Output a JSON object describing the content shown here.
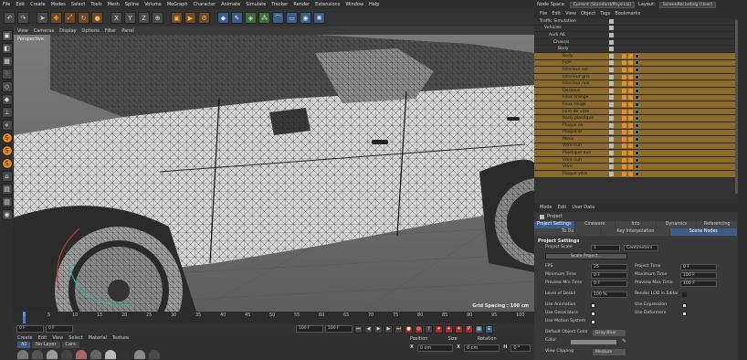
{
  "menubar": [
    "File",
    "Edit",
    "Create",
    "Modes",
    "Select",
    "Tools",
    "Mesh",
    "Spline",
    "Volume",
    "MoGraph",
    "Character",
    "Animate",
    "Simulate",
    "Tracker",
    "Render",
    "Extensions",
    "Window",
    "Help"
  ],
  "topright": {
    "node_space_label": "Node Space:",
    "node_space_value": "Current (Standard/Physical)",
    "layout_label": "Layout:",
    "layout_value": "ScreenRecording (User)"
  },
  "toolbar_icons": [
    "undo-icon",
    "redo-icon",
    "select-icon",
    "move-icon",
    "scale-icon",
    "rotate-icon",
    "recent-icon",
    "x-axis-icon",
    "y-axis-icon",
    "z-axis-icon",
    "coord-icon",
    "render-view-icon",
    "render-icon",
    "render-settings-icon",
    "cube-icon",
    "pen-icon",
    "subdivision-icon",
    "cloner-icon",
    "deformer-icon",
    "floor-icon",
    "camera-icon",
    "light-icon"
  ],
  "viewport": {
    "menu": [
      "View",
      "Cameras",
      "Display",
      "Options",
      "Filter",
      "Panel"
    ],
    "label": "Perspective",
    "grid_spacing": "Grid Spacing : 100 cm"
  },
  "timeline": {
    "ticks": [
      "0",
      "5",
      "10",
      "15",
      "20",
      "25",
      "30",
      "35",
      "40",
      "45",
      "50",
      "55",
      "60",
      "65",
      "70",
      "75",
      "80",
      "85",
      "90",
      "95",
      "100"
    ],
    "start_field": "0 F",
    "current_field": "0 F",
    "end_field": "100 F",
    "end_field2": "100 F",
    "frame_right": "0 F"
  },
  "materials": {
    "menu": [
      "Create",
      "Edit",
      "View",
      "Select",
      "Material",
      "Texture"
    ],
    "tabs": [
      "All",
      "No Layer",
      "Cars"
    ],
    "active_tab": 0
  },
  "coordinates": {
    "headers": [
      "Position",
      "Size",
      "Rotation"
    ],
    "row": {
      "axis": "X",
      "pos": "0 cm",
      "size_axis": "X",
      "size": "0 cm",
      "rot_axis": "H",
      "rot": "0 °"
    }
  },
  "objects": {
    "menu": [
      "File",
      "Edit",
      "View",
      "Object",
      "Tags",
      "Bookmarks"
    ],
    "rows": [
      {
        "name": "Traffic Simulation",
        "indent": 0,
        "hl": false
      },
      {
        "name": "Vehicles",
        "indent": 1,
        "hl": false
      },
      {
        "name": "Audi A6",
        "indent": 2,
        "hl": false
      },
      {
        "name": "Chassis",
        "indent": 3,
        "hl": false
      },
      {
        "name": "Body",
        "indent": 4,
        "hl": false
      },
      {
        "name": "Body",
        "indent": 5,
        "hl": true
      },
      {
        "name": "Jupe",
        "indent": 5,
        "hl": true
      },
      {
        "name": "Interieur sol",
        "indent": 5,
        "hl": true
      },
      {
        "name": "Interieur gris",
        "indent": 5,
        "hl": true
      },
      {
        "name": "Interieur noir",
        "indent": 5,
        "hl": true
      },
      {
        "name": "Dessous",
        "indent": 5,
        "hl": true
      },
      {
        "name": "Feux orange",
        "indent": 5,
        "hl": true
      },
      {
        "name": "Feux rouge",
        "indent": 5,
        "hl": true
      },
      {
        "name": "Joint de vitre",
        "indent": 5,
        "hl": true
      },
      {
        "name": "Body plastique",
        "indent": 5,
        "hl": true
      },
      {
        "name": "Plaque av",
        "indent": 5,
        "hl": true
      },
      {
        "name": "Plaque ar",
        "indent": 5,
        "hl": true
      },
      {
        "name": "Mesa",
        "indent": 5,
        "hl": true
      },
      {
        "name": "Vitre nun",
        "indent": 5,
        "hl": true
      },
      {
        "name": "Plastique nun",
        "indent": 5,
        "hl": true
      },
      {
        "name": "Vitre nun",
        "indent": 5,
        "hl": true
      },
      {
        "name": "Vitre",
        "indent": 5,
        "hl": true
      },
      {
        "name": "Plaque vitre",
        "indent": 5,
        "hl": true
      }
    ]
  },
  "attributes": {
    "menu": [
      "Mode",
      "Edit",
      "User Data"
    ],
    "title": "Project",
    "tabs1": [
      "Project Settings",
      "Cineware",
      "Info",
      "Dynamics",
      "Referencing"
    ],
    "tabs2": [
      "To Do",
      "Key Interpolation",
      "Scene Nodes"
    ],
    "section": "Project Settings",
    "project_scale_label": "Project Scale",
    "project_scale_value": "1",
    "project_scale_unit": "Centimeters",
    "scale_button": "Scale Project...",
    "fps_label": "FPS",
    "fps_value": "25",
    "project_time_label": "Project Time",
    "project_time_value": "0 F",
    "min_time_label": "Minimum Time",
    "min_time_value": "0 F",
    "max_time_label": "Maximum Time",
    "max_time_value": "100 F",
    "prev_min_label": "Preview Min Time",
    "prev_min_value": "0 F",
    "prev_max_label": "Preview Max Time",
    "prev_max_value": "100 F",
    "lod_label": "Level of Detail",
    "lod_value": "100 %",
    "render_lod_label": "Render LOD in Editor",
    "use_anim_label": "Use Animation",
    "use_expr_label": "Use Expression",
    "use_gen_label": "Use Generators",
    "use_deform_label": "Use Deformers",
    "use_motion_label": "Use Motion System",
    "default_color_label": "Default Object Color",
    "default_color_value": "Gray-Blue",
    "color_label": "Color",
    "view_clip_label": "View Clipping",
    "view_clip_value": "Medium"
  },
  "colors": {
    "accent_blue": "#3b5c86",
    "highlight_orange": "#8b6b2d",
    "tag_orange": "#e0902a"
  }
}
